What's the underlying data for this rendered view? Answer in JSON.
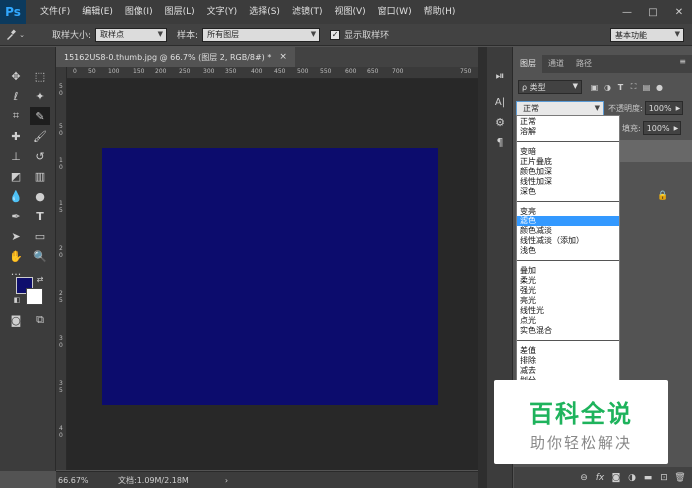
{
  "app": {
    "logo": "Ps"
  },
  "menu": [
    "文件(F)",
    "编辑(E)",
    "图像(I)",
    "图层(L)",
    "文字(Y)",
    "选择(S)",
    "滤镜(T)",
    "视图(V)",
    "窗口(W)",
    "帮助(H)"
  ],
  "window_controls": {
    "minimize": "—",
    "restore": "□",
    "close": "✕"
  },
  "options": {
    "sample_size_label": "取样大小:",
    "sample_size_value": "取样点",
    "sample_label": "样本:",
    "sample_value": "所有图层",
    "show_ring_label": "显示取样环",
    "show_ring_checked": "✓",
    "workspace": "基本功能"
  },
  "document": {
    "tab_title": "15162US8-0.thumb.jpg @ 66.7% (图层 2, RGB/8#) *",
    "tab_close": "×",
    "canvas_color": "#0c0c6d",
    "ruler_h": [
      "0",
      "50",
      "100",
      "150",
      "200",
      "250",
      "300",
      "350",
      "400",
      "450",
      "500",
      "550",
      "600",
      "650",
      "700",
      "750"
    ],
    "ruler_v": [
      "5",
      "0",
      "5",
      "0",
      "1",
      "0",
      "1",
      "5",
      "2",
      "0",
      "2",
      "5",
      "3",
      "0",
      "3",
      "5",
      "4",
      "0"
    ]
  },
  "status": {
    "zoom": "66.67%",
    "doc_size": "文档:1.09M/2.18M",
    "arrow": "›"
  },
  "colors": {
    "foreground": "#0e0e6d",
    "background": "#ffffff",
    "accent": "#3399ff"
  },
  "layers_panel": {
    "tabs": [
      "图层",
      "通道",
      "路径"
    ],
    "menu_icon": "≡",
    "filter_label": "ρ 类型",
    "blend_value": "正常",
    "opacity_label": "不透明度:",
    "opacity_value": "100%",
    "fill_label": "填充:",
    "fill_value": "100%"
  },
  "blend_modes": {
    "groups": [
      [
        "正常",
        "溶解"
      ],
      [
        "变暗",
        "正片叠底",
        "颜色加深",
        "线性加深",
        "深色"
      ],
      [
        "变亮",
        "滤色",
        "颜色减淡",
        "线性减淡（添加）",
        "浅色"
      ],
      [
        "叠加",
        "柔光",
        "强光",
        "亮光",
        "线性光",
        "点光",
        "实色混合"
      ],
      [
        "差值",
        "排除",
        "减去",
        "划分"
      ]
    ],
    "selected": "滤色"
  },
  "watermark": {
    "title": "百科全说",
    "subtitle": "助你轻松解决"
  }
}
